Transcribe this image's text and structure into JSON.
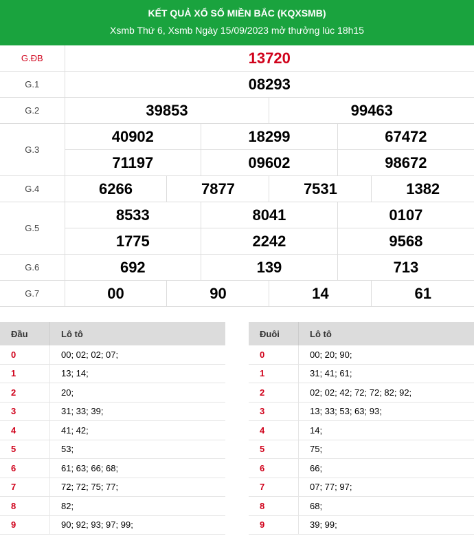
{
  "header": {
    "title": "KẾT QUẢ XỔ SỐ MIỀN BẮC (KQXSMB)",
    "subtitle": "Xsmb Thứ 6, Xsmb Ngày 15/09/2023 mở thưởng lúc 18h15"
  },
  "results": {
    "gdb": {
      "label": "G.ĐB",
      "values": [
        "13720"
      ]
    },
    "g1": {
      "label": "G.1",
      "values": [
        "08293"
      ]
    },
    "g2": {
      "label": "G.2",
      "values": [
        "39853",
        "99463"
      ]
    },
    "g3": {
      "label": "G.3",
      "values": [
        "40902",
        "18299",
        "67472",
        "71197",
        "09602",
        "98672"
      ]
    },
    "g4": {
      "label": "G.4",
      "values": [
        "6266",
        "7877",
        "7531",
        "1382"
      ]
    },
    "g5": {
      "label": "G.5",
      "values": [
        "8533",
        "8041",
        "0107",
        "1775",
        "2242",
        "9568"
      ]
    },
    "g6": {
      "label": "G.6",
      "values": [
        "692",
        "139",
        "713"
      ]
    },
    "g7": {
      "label": "G.7",
      "values": [
        "00",
        "90",
        "14",
        "61"
      ]
    }
  },
  "dau": {
    "col1": "Đầu",
    "col2": "Lô tô",
    "rows": [
      {
        "k": "0",
        "v": "00; 02; 02; 07;"
      },
      {
        "k": "1",
        "v": "13; 14;"
      },
      {
        "k": "2",
        "v": "20;"
      },
      {
        "k": "3",
        "v": "31; 33; 39;"
      },
      {
        "k": "4",
        "v": "41; 42;"
      },
      {
        "k": "5",
        "v": "53;"
      },
      {
        "k": "6",
        "v": "61; 63; 66; 68;"
      },
      {
        "k": "7",
        "v": "72; 72; 75; 77;"
      },
      {
        "k": "8",
        "v": "82;"
      },
      {
        "k": "9",
        "v": "90; 92; 93; 97; 99;"
      }
    ]
  },
  "duoi": {
    "col1": "Đuôi",
    "col2": "Lô tô",
    "rows": [
      {
        "k": "0",
        "v": "00; 20; 90;"
      },
      {
        "k": "1",
        "v": "31; 41; 61;"
      },
      {
        "k": "2",
        "v": "02; 02; 42; 72; 72; 82; 92;"
      },
      {
        "k": "3",
        "v": "13; 33; 53; 63; 93;"
      },
      {
        "k": "4",
        "v": "14;"
      },
      {
        "k": "5",
        "v": "75;"
      },
      {
        "k": "6",
        "v": "66;"
      },
      {
        "k": "7",
        "v": "07; 77; 97;"
      },
      {
        "k": "8",
        "v": "68;"
      },
      {
        "k": "9",
        "v": "39; 99;"
      }
    ]
  }
}
